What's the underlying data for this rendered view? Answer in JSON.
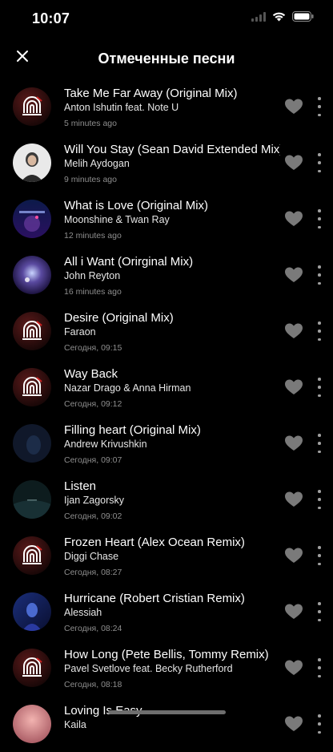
{
  "status": {
    "time": "10:07"
  },
  "header": {
    "title": "Отмеченные песни"
  },
  "colors": {
    "background": "#000000",
    "heart": "#7a7a7a",
    "secondary_text": "#8e8e8e"
  },
  "icons": {
    "close": "close-icon",
    "heart": "heart-icon",
    "more": "more-vertical-icon"
  },
  "tracks": [
    {
      "title": "Take Me Far Away (Original Mix)",
      "artist": "Anton Ishutin feat. Note U",
      "time": "5 minutes ago",
      "cover": "logo"
    },
    {
      "title": "Will You Stay (Sean David Extended Mix)",
      "artist": "Melih Aydogan",
      "time": "9 minutes ago",
      "cover": "portrait"
    },
    {
      "title": "What is Love (Original Mix)",
      "artist": "Moonshine & Twan Ray",
      "time": "12 minutes ago",
      "cover": "space"
    },
    {
      "title": "All i Want (Orirginal Mix)",
      "artist": "John Reyton",
      "time": "16 minutes ago",
      "cover": "galaxy"
    },
    {
      "title": "Desire (Original Mix)",
      "artist": "Faraon",
      "time": "Сегодня, 09:15",
      "cover": "logo"
    },
    {
      "title": "Way Back",
      "artist": "Nazar Drago & Anna Hirman",
      "time": "Сегодня, 09:12",
      "cover": "logo"
    },
    {
      "title": "Filling heart (Original Mix)",
      "artist": "Andrew Krivushkin",
      "time": "Сегодня, 09:07",
      "cover": "dark-figure"
    },
    {
      "title": "Listen",
      "artist": "Ijan Zagorsky",
      "time": "Сегодня, 09:02",
      "cover": "dark-sea"
    },
    {
      "title": "Frozen Heart (Alex Ocean Remix)",
      "artist": "Diggi Chase",
      "time": "Сегодня, 08:27",
      "cover": "logo"
    },
    {
      "title": "Hurricane (Robert Cristian Remix)",
      "artist": "Alessiah",
      "time": "Сегодня, 08:24",
      "cover": "blue-girl"
    },
    {
      "title": "How Long (Pete Bellis, Tommy Remix)",
      "artist": "Pavel Svetlove feat. Becky Rutherford",
      "time": "Сегодня, 08:18",
      "cover": "logo"
    },
    {
      "title": "Loving Is Easy",
      "artist": "Kaila",
      "time": "",
      "cover": "pink"
    }
  ]
}
